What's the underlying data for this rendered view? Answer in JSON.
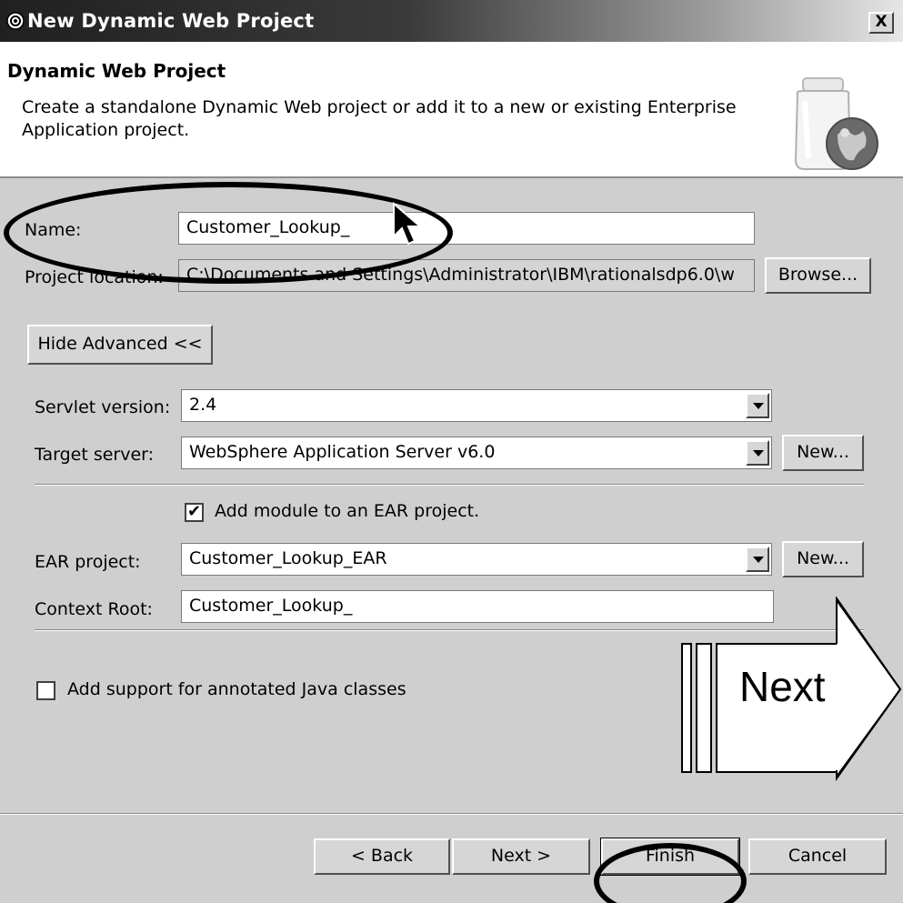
{
  "window": {
    "title": "New Dynamic Web Project",
    "close_label": "X"
  },
  "banner": {
    "title": "Dynamic Web Project",
    "description": "Create a standalone Dynamic Web project or add it to a new or existing Enterprise Application project."
  },
  "form": {
    "name_label": "Name:",
    "name_value": "Customer_Lookup_",
    "location_label": "Project location:",
    "location_value": "C:\\Documents and Settings\\Administrator\\IBM\\rationalsdp6.0\\w",
    "browse_label": "Browse...",
    "hide_advanced_label": "Hide Advanced <<",
    "servlet_label": "Servlet version:",
    "servlet_value": "2.4",
    "target_label": "Target server:",
    "target_value": "WebSphere Application Server v6.0",
    "target_new_label": "New...",
    "add_module_label": "Add module to an EAR project.",
    "ear_label": "EAR project:",
    "ear_value": "Customer_Lookup_EAR",
    "ear_new_label": "New...",
    "context_label": "Context Root:",
    "context_value": "Customer_Lookup_",
    "annotated_label": "Add support for annotated Java classes"
  },
  "buttons": {
    "back": "< Back",
    "next": "Next >",
    "finish": "Finish",
    "cancel": "Cancel"
  },
  "callout": {
    "label": "Next"
  },
  "state": {
    "add_module_checked": true,
    "annotated_checked": false
  }
}
